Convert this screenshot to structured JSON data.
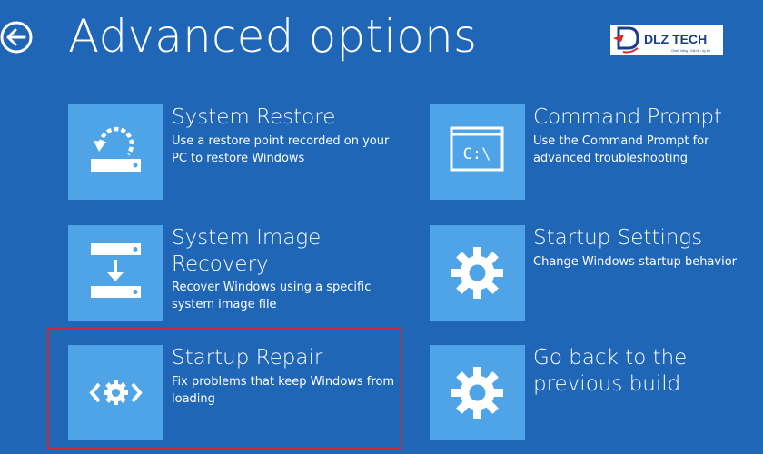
{
  "header": {
    "title": "Advanced options",
    "back_icon": "back-arrow-icon"
  },
  "logo": {
    "text": "DLZ TECH",
    "tagline": "Chinh hãng - Giá rẻ - Uy tín",
    "colors": {
      "primary": "#1a3f8a",
      "accent": "#e2252b",
      "background": "#ffffff"
    }
  },
  "options": [
    {
      "title": "System Restore",
      "description": "Use a restore point recorded on your PC to restore Windows",
      "icon": "system-restore-icon"
    },
    {
      "title": "Command Prompt",
      "description": "Use the Command Prompt for advanced troubleshooting",
      "icon": "command-prompt-icon",
      "icon_text": "C:\\"
    },
    {
      "title": "System Image Recovery",
      "description": "Recover Windows using a specific system image file",
      "icon": "system-image-recovery-icon"
    },
    {
      "title": "Startup Settings",
      "description": "Change Windows startup behavior",
      "icon": "gear-icon"
    },
    {
      "title": "Startup Repair",
      "description": "Fix problems that keep Windows from loading",
      "icon": "startup-repair-icon",
      "highlighted": true
    },
    {
      "title": "Go back to the previous build",
      "description": "",
      "icon": "gear-icon"
    }
  ],
  "colors": {
    "background": "#1f66b7",
    "tile": "#4ea4e7",
    "text": "#ffffff",
    "highlight": "#d3252f"
  }
}
